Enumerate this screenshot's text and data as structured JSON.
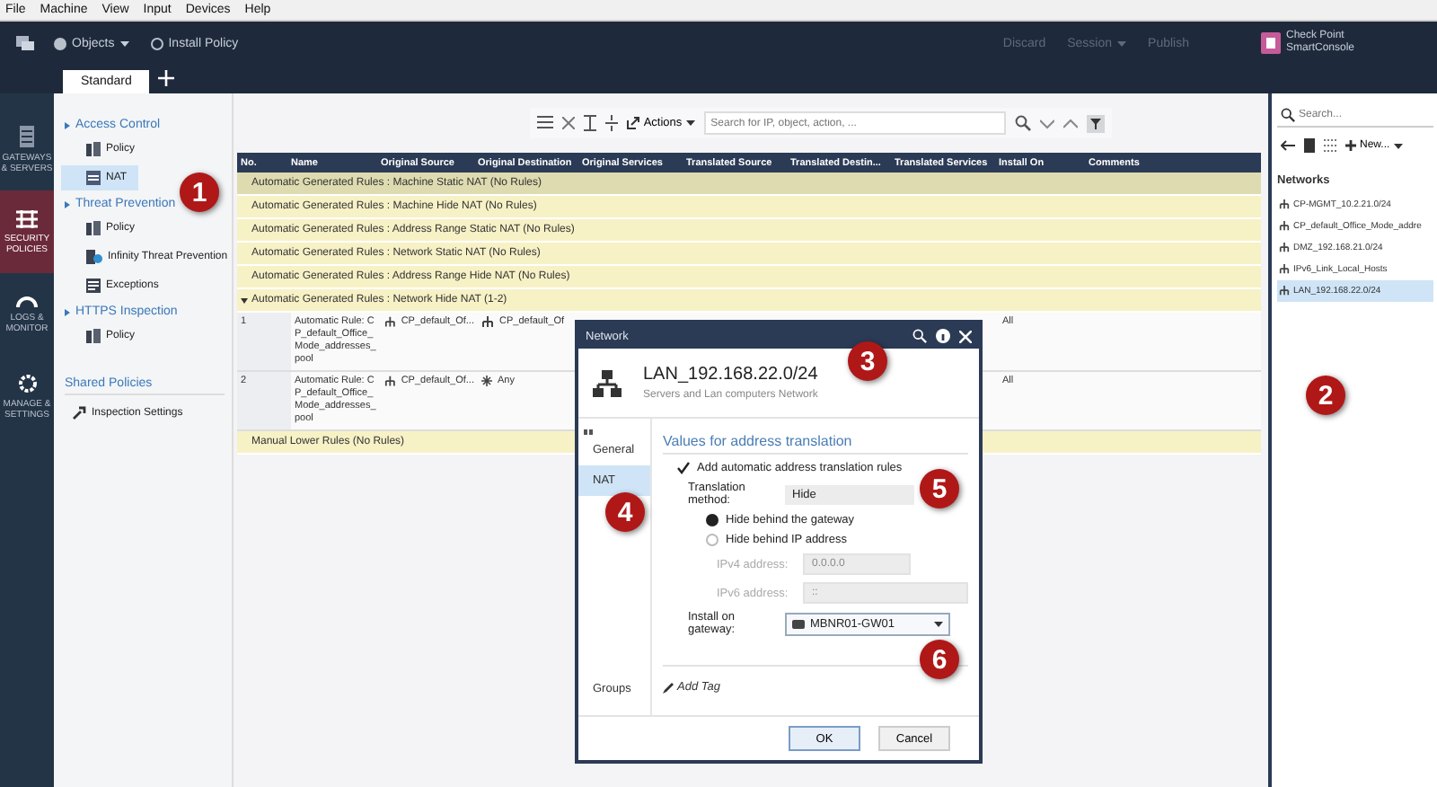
{
  "menu_bar": [
    "File",
    "Machine",
    "View",
    "Input",
    "Devices",
    "Help"
  ],
  "toolbar": {
    "objects": "Objects",
    "install": "Install Policy",
    "discard": "Discard",
    "session": "Session",
    "publish": "Publish"
  },
  "logo": {
    "line1": "Check Point",
    "line2": "SmartConsole"
  },
  "tabs": [
    {
      "label": "Standard",
      "selected": true
    }
  ],
  "nav": [
    {
      "label": "GATEWAYS & SERVERS",
      "kind": "gateway",
      "selected": false
    },
    {
      "label": "SECURITY POLICIES",
      "kind": "policies",
      "selected": true
    },
    {
      "label": "LOGS & MONITOR",
      "kind": "logs",
      "selected": false
    },
    {
      "label": "MANAGE & SETTINGS",
      "kind": "settings",
      "selected": false
    }
  ],
  "tree": [
    {
      "label": "Access Control",
      "expanded": true,
      "children": [
        {
          "label": "Policy",
          "kind": "policy",
          "selected": false
        },
        {
          "label": "NAT",
          "kind": "nat",
          "selected": true
        }
      ]
    },
    {
      "label": "Threat Prevention",
      "expanded": true,
      "children": [
        {
          "label": "Policy",
          "kind": "policy",
          "selected": false
        },
        {
          "label": "Infinity Threat Prevention",
          "kind": "threat",
          "selected": false
        },
        {
          "label": "Exceptions",
          "kind": "exceptions",
          "selected": false
        }
      ]
    },
    {
      "label": "HTTPS Inspection",
      "expanded": true,
      "children": [
        {
          "label": "Policy",
          "kind": "policy",
          "selected": false
        }
      ]
    }
  ],
  "shared": {
    "heading": "Shared Policies",
    "items": [
      "Inspection Settings"
    ]
  },
  "rule_toolbar": {
    "actions": "Actions",
    "search_placeholder": "Search for IP, object, action, ..."
  },
  "table": {
    "columns": [
      "No.",
      "Name",
      "Original Source",
      "Original Destination",
      "Original Services",
      "Translated Source",
      "Translated Destin...",
      "Translated Services",
      "Install On",
      "Comments"
    ],
    "sections": [
      {
        "label": "Automatic Generated Rules : Machine Static NAT",
        "count": "(No Rules)",
        "selected": true,
        "expanded": false
      },
      {
        "label": "Automatic Generated Rules : Machine Hide NAT",
        "count": "(No Rules)",
        "selected": false,
        "expanded": false
      },
      {
        "label": "Automatic Generated Rules : Address Range Static NAT",
        "count": "(No Rules)",
        "selected": false,
        "expanded": false
      },
      {
        "label": "Automatic Generated Rules : Network Static NAT",
        "count": "(No Rules)",
        "selected": false,
        "expanded": false
      },
      {
        "label": "Automatic Generated Rules : Address Range Hide NAT",
        "count": "(No Rules)",
        "selected": false,
        "expanded": false
      },
      {
        "label": "Automatic Generated Rules : Network Hide NAT",
        "count": "(1-2)",
        "selected": false,
        "expanded": true,
        "rows": [
          {
            "no": "1",
            "name": "Automatic Rule: CP_default_Office_Mode_addresses_pool",
            "original_source": "CP_default_Of...",
            "original_destination": {
              "text": "CP_default_Of",
              "kind": "network"
            },
            "install_on": "All"
          },
          {
            "no": "2",
            "name": "Automatic Rule: CP_default_Office_Mode_addresses_pool",
            "original_source": "CP_default_Of...",
            "original_destination": {
              "text": "Any",
              "kind": "any"
            },
            "install_on": "All"
          }
        ]
      },
      {
        "label": "Manual Lower Rules",
        "count": "(No Rules)",
        "selected": false,
        "expanded": false
      }
    ]
  },
  "objects_panel": {
    "search_placeholder": "Search...",
    "new_button": "New...",
    "heading": "Networks",
    "items": [
      {
        "label": "CP-MGMT_10.2.21.0/24",
        "selected": false
      },
      {
        "label": "CP_default_Office_Mode_addre",
        "selected": false
      },
      {
        "label": "DMZ_192.168.21.0/24",
        "selected": false
      },
      {
        "label": "IPv6_Link_Local_Hosts",
        "selected": false
      },
      {
        "label": "LAN_192.168.22.0/24",
        "selected": true
      }
    ]
  },
  "dialog": {
    "title": "Network",
    "name": "LAN_192.168.22.0/24",
    "comment": "Servers and Lan computers Network",
    "pages": [
      {
        "label": "General",
        "selected": false
      },
      {
        "label": "NAT",
        "selected": true
      }
    ],
    "bottom_page": {
      "label": "Groups",
      "selected": false
    },
    "section_title": "Values for address translation",
    "auto_rules": {
      "label": "Add automatic address translation rules",
      "checked": true
    },
    "method": {
      "label": "Translation method:",
      "value": "Hide"
    },
    "hide_options": [
      {
        "label": "Hide behind the gateway",
        "selected": true
      },
      {
        "label": "Hide behind IP address",
        "selected": false
      }
    ],
    "ipv4": {
      "label": "IPv4 address:",
      "value": "0.0.0.0",
      "disabled": true
    },
    "ipv6": {
      "label": "IPv6 address:",
      "value": "::",
      "disabled": true
    },
    "gateway": {
      "label": "Install on gateway:",
      "value": "MBNR01-GW01"
    },
    "add_tag": "Add Tag",
    "buttons": [
      "OK",
      "Cancel"
    ]
  },
  "callouts": [
    "1",
    "2",
    "3",
    "4",
    "5",
    "6"
  ]
}
